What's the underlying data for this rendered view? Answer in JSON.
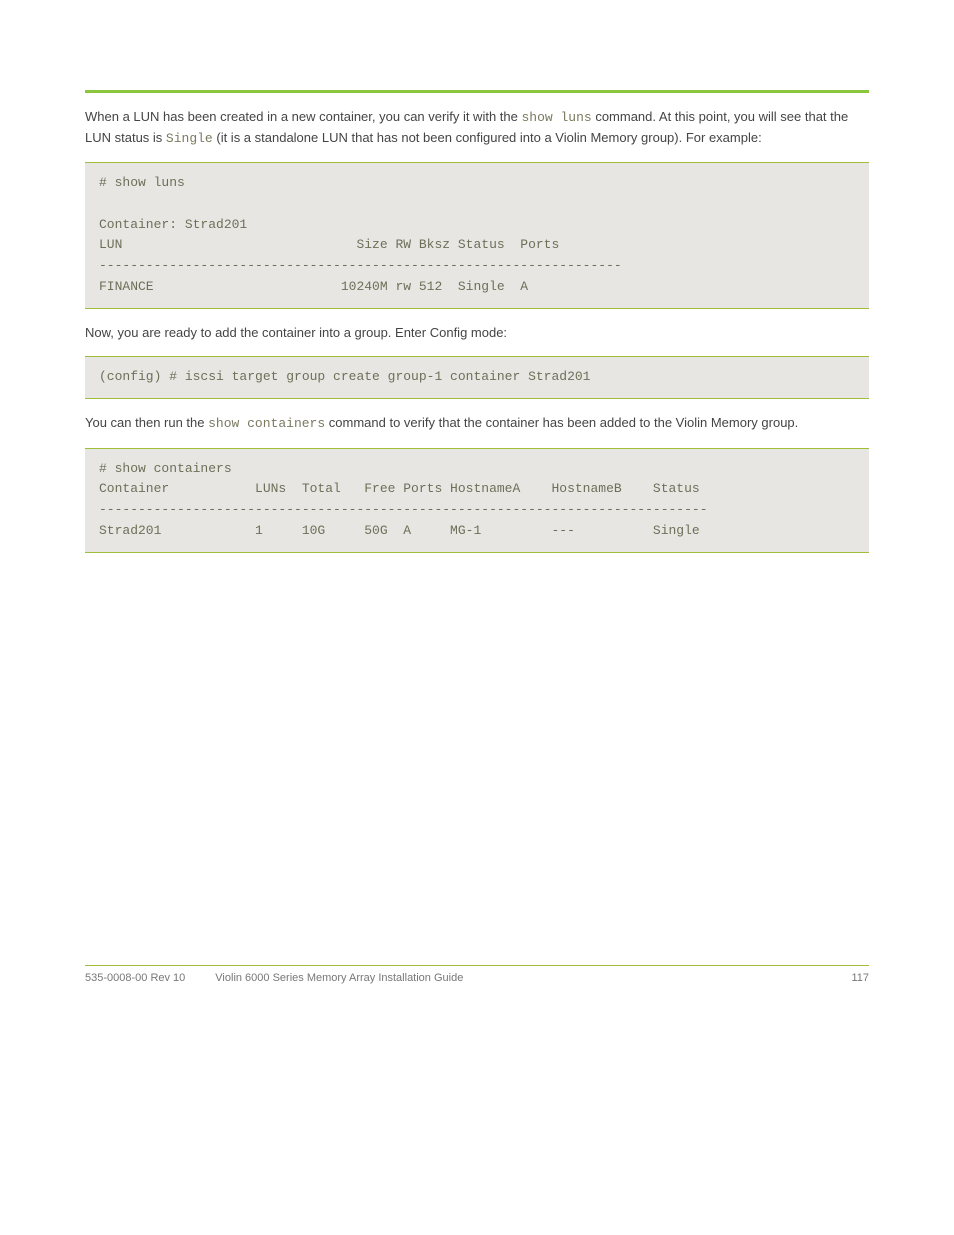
{
  "para1": {
    "t1": "When a LUN has been created in a new container, you can verify it with the ",
    "cmd": "show luns",
    "t2": " command. At this point, you will see that the LUN status is ",
    "status": "Single",
    "t3": " (it is a standalone LUN that has not been configured into a Violin Memory group). For example:"
  },
  "code1": "# show luns\n\nContainer: Strad201\nLUN                              Size RW Bksz Status  Ports\n-------------------------------------------------------------------\nFINANCE                        10240M rw 512  Single  A",
  "para2": "Now, you are ready to add the container into a group. Enter Config mode:",
  "code2": "(config) # iscsi target group create group-1 container Strad201",
  "para3": {
    "t1": "You can then run the ",
    "cmd": "show containers",
    "t2": " command to verify that the container has been added to the Violin Memory group."
  },
  "code3": "# show containers\nContainer           LUNs  Total   Free Ports HostnameA    HostnameB    Status\n------------------------------------------------------------------------------\nStrad201            1     10G     50G  A     MG-1         ---          Single",
  "footer": {
    "left1": "535-0008-00 Rev 10",
    "left2": "Violin 6000 Series Memory Array Installation Guide",
    "right": "117"
  }
}
